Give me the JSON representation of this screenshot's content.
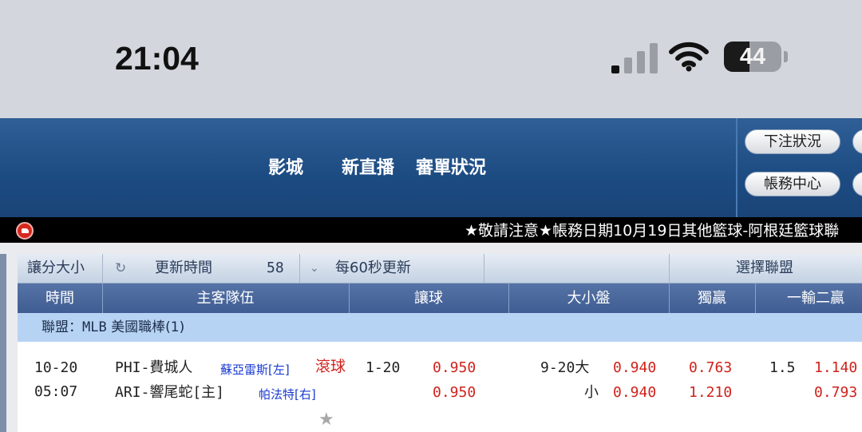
{
  "status_bar": {
    "time": "21:04",
    "signal_bars_active": 1,
    "signal_bars_total": 4,
    "battery_percent": "44",
    "battery_level": 0.44
  },
  "header": {
    "nav": [
      "影城",
      "新直播",
      "審單狀況"
    ],
    "buttons": [
      "下注狀況",
      "帳務中心"
    ]
  },
  "ticker": {
    "text": "★敬請注意★帳務日期10月19日其他籃球-阿根廷籃球聯"
  },
  "toolbar": {
    "mode": "讓分大小",
    "refresh_label": "更新時間",
    "countdown": "58",
    "interval": "每60秒更新",
    "league_select": "選擇聯盟"
  },
  "table": {
    "headers": [
      "時間",
      "主客隊伍",
      "讓球",
      "大小盤",
      "獨贏",
      "一輸二贏"
    ]
  },
  "league": {
    "prefix": "聯盟：",
    "code": "MLB",
    "name": "美國職棒(1)"
  },
  "match": {
    "date": "10-20",
    "time": "05:07",
    "home_team": "PHI-費城人",
    "home_pitcher": "蘇亞雷斯[左]",
    "live_label": "滾球",
    "away_team": "ARI-響尾蛇[主]",
    "away_pitcher": "帕法特[右]",
    "handicap_line": "1-20",
    "handicap_odds_home": "0.950",
    "handicap_odds_away": "0.950",
    "ou_line": "9-20",
    "over_label": "大",
    "over_odds": "0.940",
    "under_label": "小",
    "under_odds": "0.940",
    "ml_home": "0.763",
    "ml_away": "1.210",
    "alt_line": "1.5",
    "alt_odds_home": "1.140",
    "alt_odds_away": "0.793"
  },
  "colors": {
    "header_blue": "#1c4b82",
    "odds_red": "#d0221c",
    "pitcher_blue": "#1a3bd0",
    "league_bar": "#b7d3f4"
  }
}
